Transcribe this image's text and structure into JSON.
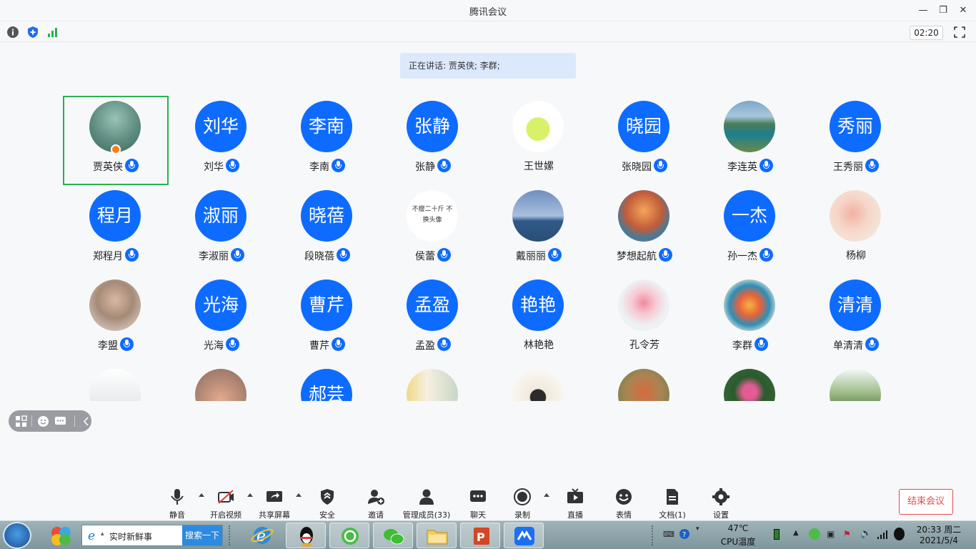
{
  "window": {
    "title": "腾讯会议",
    "controls": [
      "minimize",
      "restore",
      "close"
    ]
  },
  "infobar": {
    "icons": [
      "info-icon",
      "shield-icon",
      "signal-icon"
    ],
    "timer": "02:20",
    "fullscreen_icon": "fullscreen-icon"
  },
  "speaking": {
    "label": "正在讲话: 贾英侠; 李群;"
  },
  "participants": [
    {
      "name": "贾英侠",
      "avatar_text": "",
      "photo": "forest",
      "mic": true,
      "host": true,
      "active": true
    },
    {
      "name": "刘华",
      "avatar_text": "刘华",
      "mic": true
    },
    {
      "name": "李南",
      "avatar_text": "李南",
      "mic": true
    },
    {
      "name": "张静",
      "avatar_text": "张静",
      "mic": true
    },
    {
      "name": "王世嫘",
      "avatar_text": "",
      "photo": "lemon-drink",
      "mic": false
    },
    {
      "name": "张晓园",
      "avatar_text": "晓园",
      "mic": true
    },
    {
      "name": "李连英",
      "avatar_text": "",
      "photo": "lake",
      "mic": true
    },
    {
      "name": "王秀丽",
      "avatar_text": "秀丽",
      "mic": true
    },
    {
      "name": "郑程月",
      "avatar_text": "程月",
      "mic": true
    },
    {
      "name": "李淑丽",
      "avatar_text": "淑丽",
      "mic": true
    },
    {
      "name": "段晓蓓",
      "avatar_text": "晓蓓",
      "mic": true
    },
    {
      "name": "侯蕾",
      "avatar_text": "",
      "photo": "text-image",
      "photo_caption": "不瘦二十斤 不换头像",
      "mic": true
    },
    {
      "name": "戴丽丽",
      "avatar_text": "",
      "photo": "sea",
      "mic": true
    },
    {
      "name": "梦想起航",
      "avatar_text": "",
      "photo": "windmill",
      "mic": true
    },
    {
      "name": "孙一杰",
      "avatar_text": "一杰",
      "mic": true
    },
    {
      "name": "杨柳",
      "avatar_text": "",
      "photo": "illustration",
      "mic": false
    },
    {
      "name": "李盟",
      "avatar_text": "",
      "photo": "portrait",
      "mic": true
    },
    {
      "name": "光海",
      "avatar_text": "光海",
      "mic": true
    },
    {
      "name": "曹芹",
      "avatar_text": "曹芹",
      "mic": true
    },
    {
      "name": "孟盈",
      "avatar_text": "孟盈",
      "mic": true
    },
    {
      "name": "林艳艳",
      "avatar_text": "艳艳",
      "mic": false
    },
    {
      "name": "孔令芳",
      "avatar_text": "",
      "photo": "flowers",
      "mic": false
    },
    {
      "name": "李群",
      "avatar_text": "",
      "photo": "flower-pattern",
      "mic": true
    },
    {
      "name": "单清清",
      "avatar_text": "清清",
      "mic": true
    },
    {
      "name": "",
      "avatar_text": "",
      "photo": "cups",
      "mic": false
    },
    {
      "name": "",
      "avatar_text": "",
      "photo": "girl",
      "mic": false
    },
    {
      "name": "",
      "avatar_text": "郝芸",
      "mic": false
    },
    {
      "name": "",
      "avatar_text": "",
      "photo": "family",
      "mic": false
    },
    {
      "name": "",
      "avatar_text": "",
      "photo": "cartoon",
      "mic": false
    },
    {
      "name": "",
      "avatar_text": "",
      "photo": "autumn",
      "mic": false
    },
    {
      "name": "",
      "avatar_text": "",
      "photo": "rose",
      "mic": false
    },
    {
      "name": "",
      "avatar_text": "",
      "photo": "tree",
      "mic": false
    }
  ],
  "toolbar": {
    "items": [
      {
        "label": "静音",
        "icon": "microphone-icon",
        "caret": true
      },
      {
        "label": "开启视频",
        "icon": "video-off-icon",
        "caret": true
      },
      {
        "label": "共享屏幕",
        "icon": "share-screen-icon",
        "caret": true
      },
      {
        "label": "安全",
        "icon": "security-icon",
        "caret": false
      },
      {
        "label": "邀请",
        "icon": "invite-icon",
        "caret": false
      },
      {
        "label": "管理成员(33)",
        "icon": "members-icon",
        "caret": false
      },
      {
        "label": "聊天",
        "icon": "chat-icon",
        "caret": false
      },
      {
        "label": "录制",
        "icon": "record-icon",
        "caret": true
      },
      {
        "label": "直播",
        "icon": "live-icon",
        "caret": false
      },
      {
        "label": "表情",
        "icon": "emoji-icon",
        "caret": false
      },
      {
        "label": "文档(1)",
        "icon": "document-icon",
        "caret": false
      },
      {
        "label": "设置",
        "icon": "gear-icon",
        "caret": false
      }
    ],
    "end_label": "结束会议"
  },
  "taskbar": {
    "search_text": "实时新鲜事",
    "search_button": "搜索一下",
    "temp": "47℃",
    "temp_label": "CPU温度",
    "time": "20:33 周二",
    "date": "2021/5/4"
  },
  "colors": {
    "accent": "#0e6bff",
    "active_border": "#27b34d",
    "end_red": "#e84b4b",
    "banner": "#dce9fd"
  }
}
